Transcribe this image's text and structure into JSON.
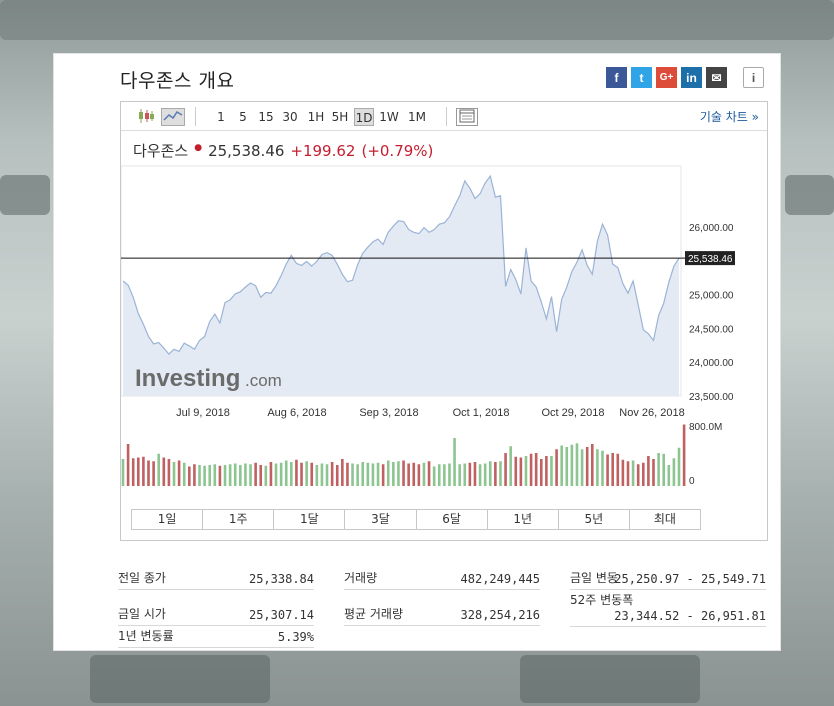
{
  "title": "다우존스 개요",
  "social": [
    "f",
    "t",
    "G+",
    "in",
    "✉",
    "i"
  ],
  "toolbar": {
    "timeframes": [
      "1",
      "5",
      "15",
      "30",
      "1H",
      "5H",
      "1D",
      "1W",
      "1M"
    ],
    "active": "1D",
    "tech_chart_link": "기술 차트 »"
  },
  "quote": {
    "name": "다우존스",
    "price": "25,538.46",
    "change": "+199.62",
    "change_pct": "(+0.79%)"
  },
  "chart_data": {
    "type": "area",
    "title": "",
    "x_ticks": [
      "Jul 9, 2018",
      "Aug 6, 2018",
      "Sep 3, 2018",
      "Oct 1, 2018",
      "Oct 29, 2018",
      "Nov 26, 2018"
    ],
    "y_ticks": [
      "26,000.00",
      "25,500.00",
      "25,000.00",
      "24,500.00",
      "24,000.00",
      "23,500.00"
    ],
    "ylim": [
      23500,
      27000
    ],
    "current_line": 25538.46,
    "current_label": "25,538.46",
    "watermark": "Investing.com",
    "close_series": [
      25200,
      25140,
      24960,
      24720,
      24560,
      24380,
      24270,
      24290,
      24210,
      24120,
      24190,
      24160,
      24280,
      24240,
      24190,
      24320,
      24380,
      24600,
      24710,
      24580,
      24880,
      24920,
      25010,
      25040,
      25110,
      25170,
      25130,
      24960,
      25030,
      25020,
      25130,
      25280,
      25450,
      25580,
      25460,
      25430,
      25490,
      25420,
      25490,
      25590,
      25620,
      25580,
      25450,
      25300,
      25190,
      25210,
      25440,
      25610,
      25700,
      25780,
      25820,
      25740,
      25920,
      26010,
      26090,
      26080,
      25960,
      25920,
      25900,
      25990,
      25920,
      25960,
      26040,
      26060,
      26150,
      26310,
      26460,
      26680,
      26570,
      26420,
      26490,
      26650,
      26750,
      26440,
      26460,
      25120,
      25370,
      25220,
      25010,
      25690,
      25200,
      25110,
      24890,
      24640,
      24970,
      24450,
      24930,
      25110,
      25340,
      25480,
      25660,
      25430,
      25300,
      25790,
      26040,
      25880,
      25450,
      25400,
      25160,
      25020,
      25200,
      24850,
      24480,
      24420,
      24320,
      24690,
      24870,
      25180,
      25420,
      25538.46
    ],
    "volume_ylim": [
      0,
      800
    ],
    "volume_ticks": [
      "800.0M",
      "0"
    ],
    "volume_series": [
      360,
      560,
      370,
      380,
      390,
      340,
      330,
      430,
      380,
      360,
      320,
      340,
      310,
      260,
      290,
      280,
      270,
      280,
      290,
      270,
      280,
      290,
      300,
      280,
      300,
      290,
      310,
      280,
      270,
      320,
      300,
      310,
      340,
      320,
      350,
      310,
      330,
      310,
      280,
      300,
      290,
      320,
      280,
      360,
      310,
      300,
      290,
      320,
      310,
      300,
      310,
      290,
      340,
      320,
      330,
      340,
      300,
      310,
      290,
      310,
      330,
      260,
      290,
      290,
      300,
      640,
      290,
      300,
      310,
      320,
      290,
      300,
      330,
      320,
      330,
      440,
      530,
      390,
      380,
      400,
      430,
      440,
      360,
      400,
      400,
      490,
      540,
      520,
      550,
      570,
      490,
      520,
      560,
      490,
      470,
      420,
      440,
      430,
      350,
      330,
      340,
      290,
      310,
      400,
      360,
      440,
      430,
      280,
      370,
      510,
      820
    ],
    "volume_colors_up": "#8dc590",
    "volume_colors_down": "#c06060"
  },
  "ranges": [
    "1일",
    "1주",
    "1달",
    "3달",
    "6달",
    "1년",
    "5년",
    "최대"
  ],
  "stats": {
    "prev_close_label": "전일 종가",
    "prev_close": "25,338.84",
    "open_label": "금일 시가",
    "open": "25,307.14",
    "yr_change_label": "1년 변동률",
    "yr_change": "5.39%",
    "volume_label": "거래량",
    "volume": "482,249,445",
    "avg_volume_label": "평균 거래량",
    "avg_volume": "328,254,216",
    "day_range_label": "금일 변동",
    "day_range": "25,250.97 - 25,549.71",
    "wk52_label": "52주 변동폭",
    "wk52": "23,344.52 - 26,951.81"
  }
}
